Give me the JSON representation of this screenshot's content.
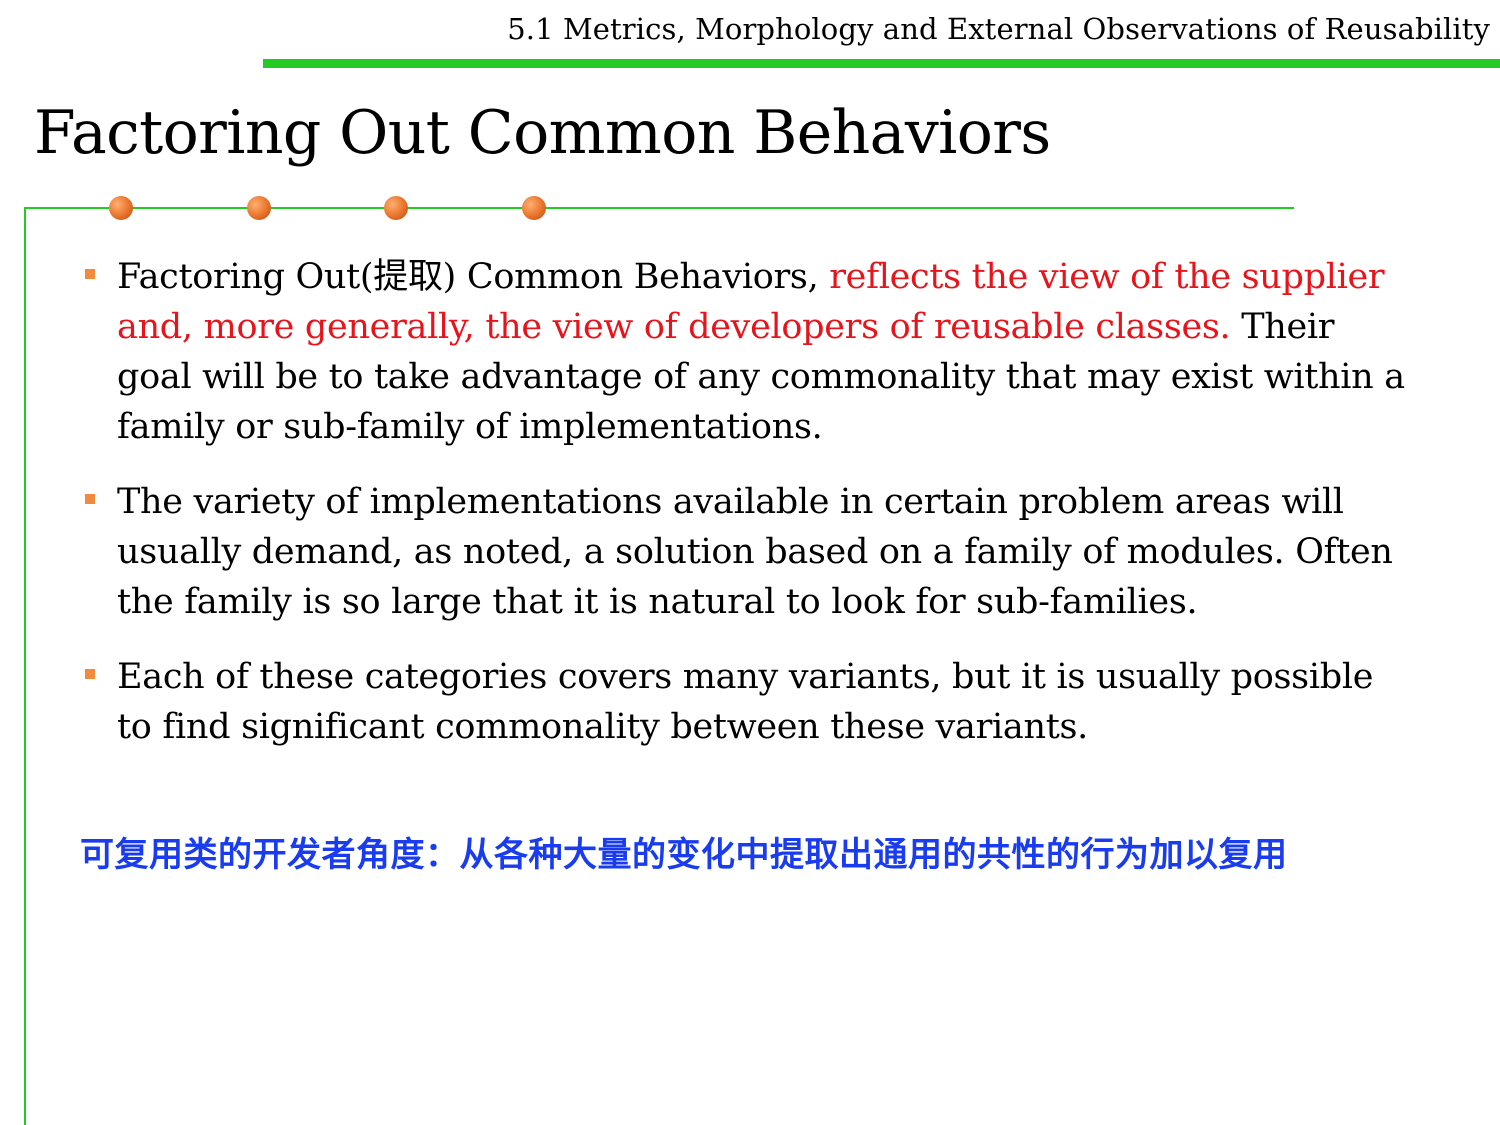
{
  "header": {
    "section_title": "5.1 Metrics, Morphology and External Observations of Reusability"
  },
  "slide": {
    "title": "Factoring Out Common Behaviors"
  },
  "bullets": [
    {
      "part1": "Factoring Out(提取) Common Behaviors, ",
      "highlight": "reflects the view of the supplier and, more generally, the view of developers of reusable classes.",
      "part2": " Their goal will be to take advantage of any commonality that may exist within a family or sub-family of implementations."
    },
    {
      "text": "The variety of implementations available in certain problem areas will usually demand, as noted, a solution based on a family of modules. Often the family is so large that it is natural to look for sub-families."
    },
    {
      "text": "Each of these categories covers many variants, but it is usually possible to find significant commonality between these variants."
    }
  ],
  "summary": {
    "text": "可复用类的开发者角度：从各种大量的变化中提取出通用的共性的行为加以复用"
  },
  "colors": {
    "accent_green": "#22cc22",
    "bullet_orange": "#f08a3c",
    "dot_orange": "#e8722a",
    "highlight_red": "#e8141c",
    "summary_blue": "#1a3cf0",
    "text": "#000000"
  },
  "icons": {
    "bullet": "square-bullet-icon",
    "decoration": "orange-dot-icon"
  }
}
